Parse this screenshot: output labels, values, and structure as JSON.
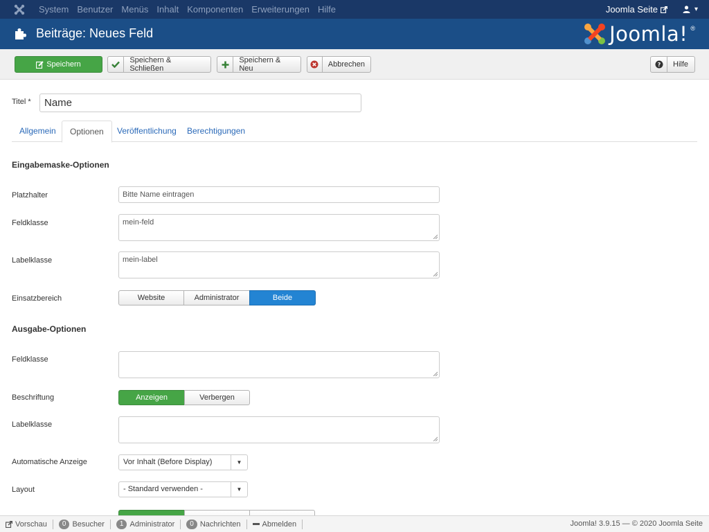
{
  "topnav": {
    "menu": [
      "System",
      "Benutzer",
      "Menüs",
      "Inhalt",
      "Komponenten",
      "Erweiterungen",
      "Hilfe"
    ],
    "site_link": "Joomla Seite"
  },
  "header": {
    "title": "Beiträge: Neues Feld",
    "brand": "Joomla!"
  },
  "toolbar": {
    "save": "Speichern",
    "save_close": "Speichern & Schließen",
    "save_new": "Speichern & Neu",
    "cancel": "Abbrechen",
    "help": "Hilfe"
  },
  "form": {
    "title_label": "Titel *",
    "title_value": "Name"
  },
  "tabs": [
    "Allgemein",
    "Optionen",
    "Veröffentlichung",
    "Berechtigungen"
  ],
  "active_tab": "Optionen",
  "input_options": {
    "heading": "Eingabemaske-Optionen",
    "placeholder_label": "Platzhalter",
    "placeholder_value": "Bitte Name eintragen",
    "field_class_label": "Feldklasse",
    "field_class_value": "mein-feld",
    "label_class_label": "Labelklasse",
    "label_class_value": "mein-label",
    "scope_label": "Einsatzbereich",
    "scope_options": [
      "Website",
      "Administrator",
      "Beide"
    ],
    "scope_selected": "Beide"
  },
  "output_options": {
    "heading": "Ausgabe-Optionen",
    "field_class_label": "Feldklasse",
    "field_class_value": "",
    "caption_label": "Beschriftung",
    "caption_options": [
      "Anzeigen",
      "Verbergen"
    ],
    "caption_selected": "Anzeigen",
    "label_class_label": "Labelklasse",
    "label_class_value": "",
    "auto_display_label": "Automatische Anzeige",
    "auto_display_value": "Vor Inhalt (Before Display)",
    "layout_label": "Layout",
    "layout_value": "- Standard verwenden -"
  },
  "statusbar": {
    "preview": "Vorschau",
    "visitors_count": "0",
    "visitors": "Besucher",
    "admins_count": "1",
    "admins": "Administrator",
    "messages_count": "0",
    "messages": "Nachrichten",
    "logout": "Abmelden",
    "copyright": "Joomla! 3.9.15 — © 2020 Joomla Seite"
  },
  "colors": {
    "topnav_bg": "#1a3867",
    "header_bg": "#1b4e87",
    "success": "#46a546",
    "primary": "#2384d3",
    "link": "#2a69b8"
  }
}
